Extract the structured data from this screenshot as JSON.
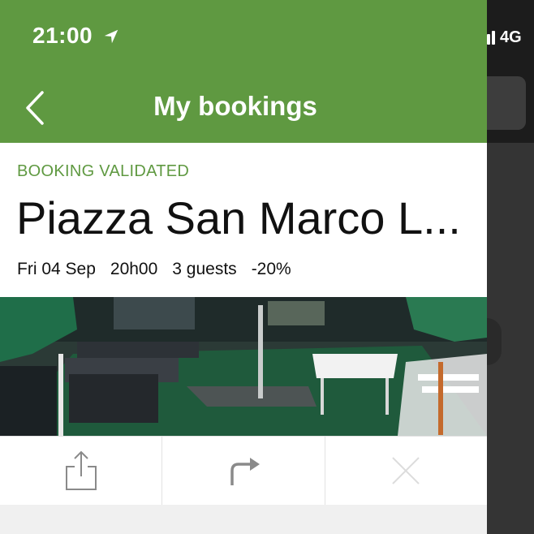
{
  "status_bar": {
    "time": "21:00",
    "network": "4G",
    "location_icon": "location-arrow-icon",
    "signal_icon": "cellular-signal-icon"
  },
  "header": {
    "title": "My bookings",
    "back_icon": "chevron-left-icon",
    "background_color": "#5f9941"
  },
  "booking": {
    "status": "BOOKING VALIDATED",
    "venue_name": "Piazza San Marco L...",
    "date": "Fri 04 Sep",
    "time": "20h00",
    "guests": "3 guests",
    "discount": "-20%",
    "photo": "restaurant-terrace-photo"
  },
  "actions": [
    {
      "icon": "share-icon"
    },
    {
      "icon": "redirect-arrow-icon"
    },
    {
      "icon": "close-icon"
    }
  ],
  "colors": {
    "accent": "#5f9941",
    "text": "#111111",
    "side_dark": "#343434"
  }
}
